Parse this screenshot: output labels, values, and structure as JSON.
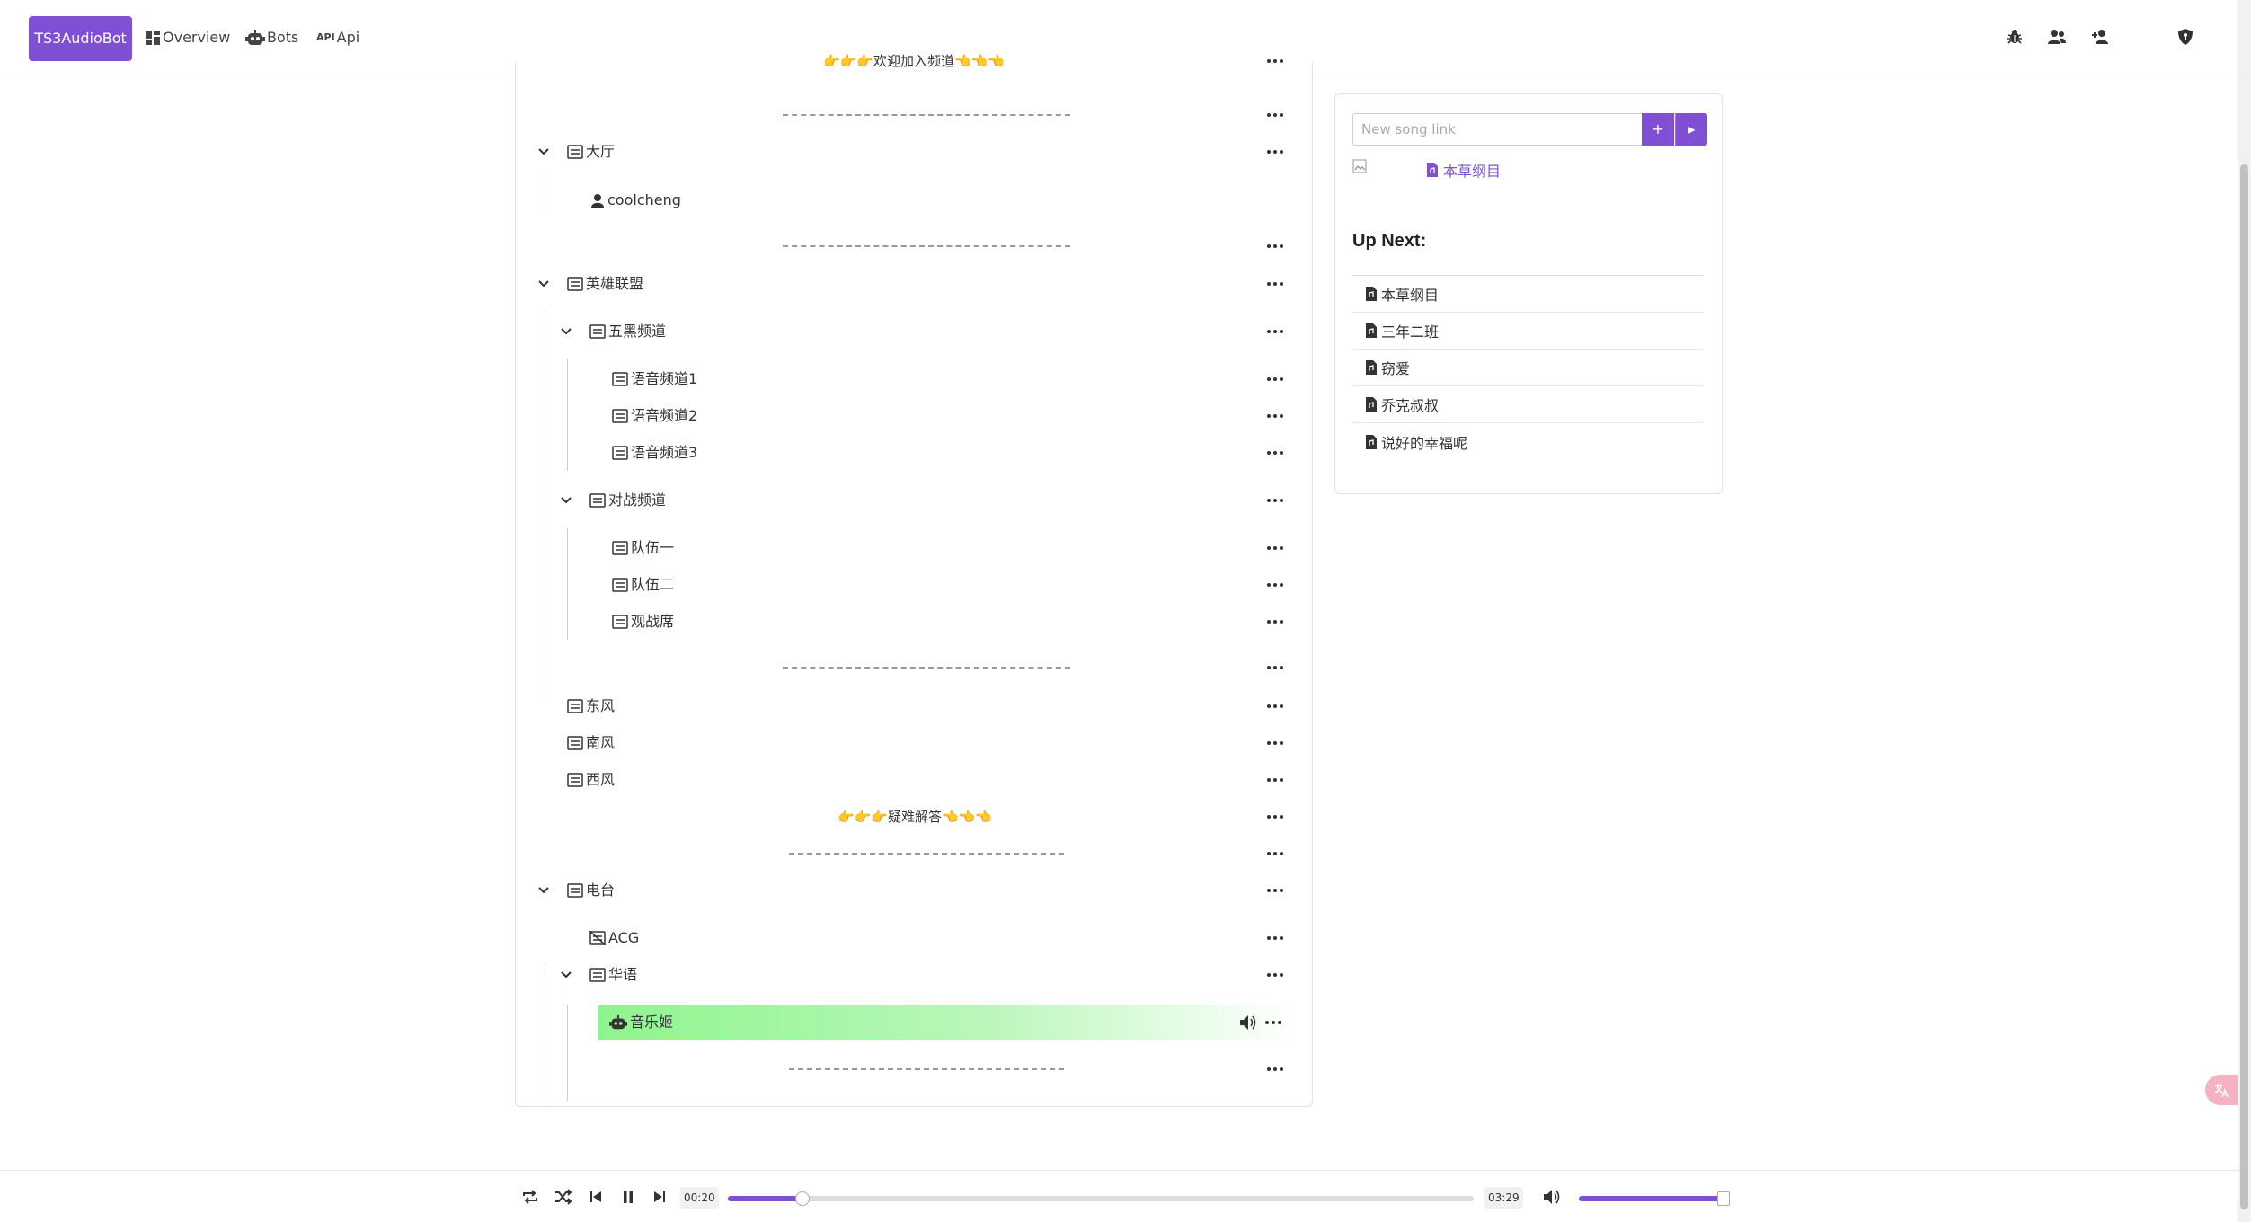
{
  "navbar": {
    "brand": "TS3AudioBot",
    "links": [
      {
        "label": "Overview",
        "icon": "dashboard-icon"
      },
      {
        "label": "Bots",
        "icon": "robot-icon"
      },
      {
        "label": "Api",
        "icon": "api-icon"
      }
    ],
    "right_icons": [
      "bug-icon",
      "users-icon",
      "user-add-icon",
      "shield-icon"
    ]
  },
  "tree": {
    "rows": [
      {
        "text": "👉👉👉欢迎加入频道👈👈👈"
      },
      {
        "text": "大厅"
      },
      {
        "text": "coolcheng"
      },
      {
        "text": "英雄联盟"
      },
      {
        "text": "五黑频道"
      },
      {
        "text": "语音频道1"
      },
      {
        "text": "语音频道2"
      },
      {
        "text": "语音频道3"
      },
      {
        "text": "对战频道"
      },
      {
        "text": "队伍一"
      },
      {
        "text": "队伍二"
      },
      {
        "text": "观战席"
      },
      {
        "text": "东风"
      },
      {
        "text": "南风"
      },
      {
        "text": "西风"
      },
      {
        "text": "👉👉👉疑难解答👈👈👈"
      },
      {
        "text": "电台"
      },
      {
        "text": "ACG"
      },
      {
        "text": "华语"
      },
      {
        "text": "音乐姬"
      }
    ]
  },
  "queue": {
    "input_placeholder": "New song link",
    "add_label": "+",
    "play_label": "▸",
    "now_playing": "本草纲目",
    "up_next_title": "Up Next:",
    "items": [
      "本草纲目",
      "三年二班",
      "窃爱",
      "乔克叔叔",
      "说好的幸福呢"
    ]
  },
  "player": {
    "current_time": "00:20",
    "total_time": "03:29",
    "progress_fraction": 0.1,
    "volume_fraction": 1.0
  },
  "colors": {
    "accent": "#7f4fd4",
    "active_row": "#8ef58e"
  }
}
